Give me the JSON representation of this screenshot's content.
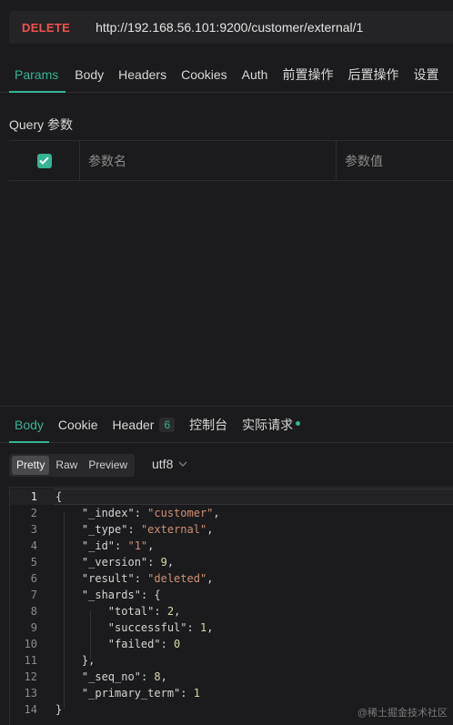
{
  "request": {
    "method": "DELETE",
    "url": "http://192.168.56.101:9200/customer/external/1"
  },
  "request_tabs": [
    "Params",
    "Body",
    "Headers",
    "Cookies",
    "Auth",
    "前置操作",
    "后置操作",
    "设置"
  ],
  "query": {
    "title": "Query 参数",
    "name_placeholder": "参数名",
    "value_placeholder": "参数值"
  },
  "response_tabs": {
    "body": "Body",
    "cookie": "Cookie",
    "header": "Header",
    "header_count": "6",
    "console": "控制台",
    "actual_request": "实际请求"
  },
  "view_modes": [
    "Pretty",
    "Raw",
    "Preview"
  ],
  "encoding": "utf8",
  "code_lines": [
    [
      {
        "t": "p",
        "v": "{"
      }
    ],
    [
      {
        "t": "p",
        "v": "    "
      },
      {
        "t": "k",
        "v": "\"_index\""
      },
      {
        "t": "p",
        "v": ": "
      },
      {
        "t": "s",
        "v": "\"customer\""
      },
      {
        "t": "p",
        "v": ","
      }
    ],
    [
      {
        "t": "p",
        "v": "    "
      },
      {
        "t": "k",
        "v": "\"_type\""
      },
      {
        "t": "p",
        "v": ": "
      },
      {
        "t": "s",
        "v": "\"external\""
      },
      {
        "t": "p",
        "v": ","
      }
    ],
    [
      {
        "t": "p",
        "v": "    "
      },
      {
        "t": "k",
        "v": "\"_id\""
      },
      {
        "t": "p",
        "v": ": "
      },
      {
        "t": "s",
        "v": "\"1\""
      },
      {
        "t": "p",
        "v": ","
      }
    ],
    [
      {
        "t": "p",
        "v": "    "
      },
      {
        "t": "k",
        "v": "\"_version\""
      },
      {
        "t": "p",
        "v": ": "
      },
      {
        "t": "n",
        "v": "9"
      },
      {
        "t": "p",
        "v": ","
      }
    ],
    [
      {
        "t": "p",
        "v": "    "
      },
      {
        "t": "k",
        "v": "\"result\""
      },
      {
        "t": "p",
        "v": ": "
      },
      {
        "t": "s",
        "v": "\"deleted\""
      },
      {
        "t": "p",
        "v": ","
      }
    ],
    [
      {
        "t": "p",
        "v": "    "
      },
      {
        "t": "k",
        "v": "\"_shards\""
      },
      {
        "t": "p",
        "v": ": {"
      }
    ],
    [
      {
        "t": "p",
        "v": "        "
      },
      {
        "t": "k",
        "v": "\"total\""
      },
      {
        "t": "p",
        "v": ": "
      },
      {
        "t": "n",
        "v": "2"
      },
      {
        "t": "p",
        "v": ","
      }
    ],
    [
      {
        "t": "p",
        "v": "        "
      },
      {
        "t": "k",
        "v": "\"successful\""
      },
      {
        "t": "p",
        "v": ": "
      },
      {
        "t": "n",
        "v": "1"
      },
      {
        "t": "p",
        "v": ","
      }
    ],
    [
      {
        "t": "p",
        "v": "        "
      },
      {
        "t": "k",
        "v": "\"failed\""
      },
      {
        "t": "p",
        "v": ": "
      },
      {
        "t": "n",
        "v": "0"
      }
    ],
    [
      {
        "t": "p",
        "v": "    },"
      }
    ],
    [
      {
        "t": "p",
        "v": "    "
      },
      {
        "t": "k",
        "v": "\"_seq_no\""
      },
      {
        "t": "p",
        "v": ": "
      },
      {
        "t": "n",
        "v": "8"
      },
      {
        "t": "p",
        "v": ","
      }
    ],
    [
      {
        "t": "p",
        "v": "    "
      },
      {
        "t": "k",
        "v": "\"_primary_term\""
      },
      {
        "t": "p",
        "v": ": "
      },
      {
        "t": "n",
        "v": "1"
      }
    ],
    [
      {
        "t": "p",
        "v": "}"
      }
    ]
  ],
  "watermark": "@稀土掘金技术社区",
  "colors": {
    "accent": "#35b394",
    "method": "#f0524a",
    "string": "#ce9178",
    "number": "#d7d7a8"
  }
}
